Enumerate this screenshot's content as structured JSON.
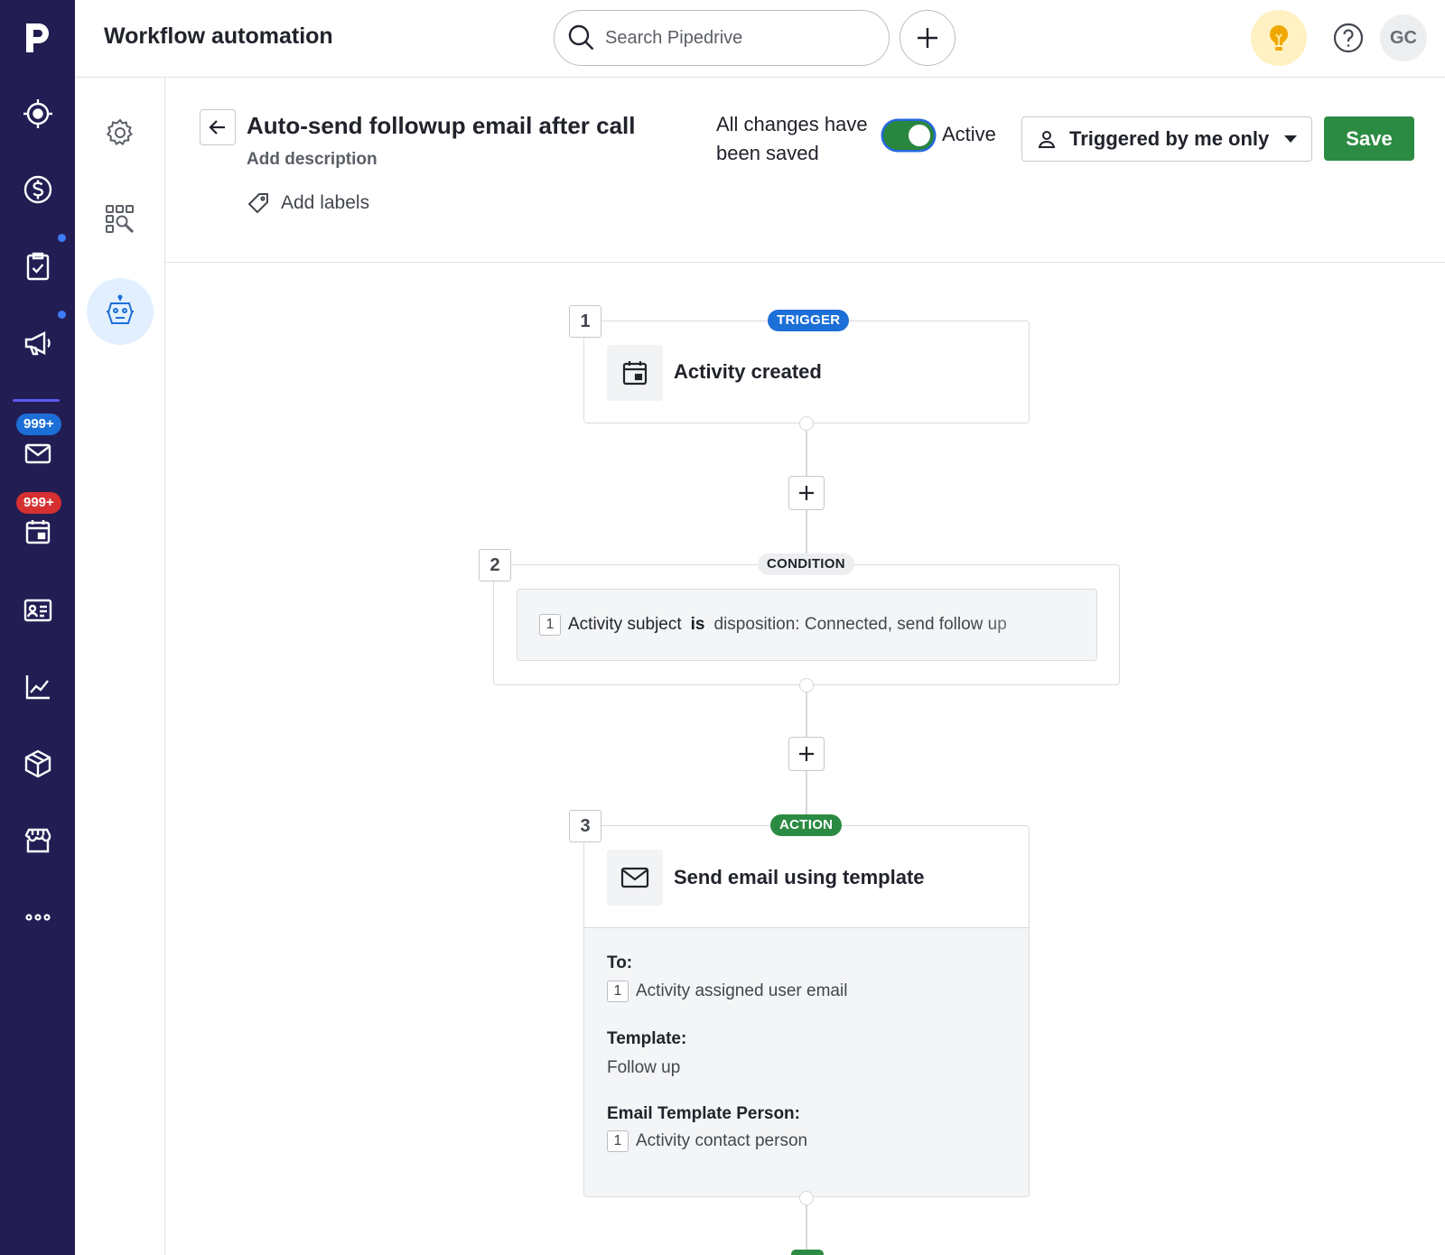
{
  "app": {
    "page_title": "Workflow automation",
    "search_placeholder": "Search Pipedrive",
    "avatar_initials": "GC",
    "brand_color": "#221d53",
    "accent_color": "#2c8b43"
  },
  "rail": {
    "badges": {
      "mail": "999+",
      "calendar": "999+"
    },
    "icons": [
      "target-icon",
      "dollar-icon",
      "clipboard-icon",
      "megaphone-icon",
      "mail-icon",
      "calendar-icon",
      "contacts-icon",
      "chart-icon",
      "box-icon",
      "store-icon",
      "more-icon"
    ]
  },
  "workflow": {
    "title": "Auto-send followup email after call",
    "description_placeholder": "Add description",
    "labels_placeholder": "Add labels",
    "save_status": "All changes have been saved",
    "active_label": "Active",
    "active": true,
    "trigger_scope": "Triggered by me only",
    "save_label": "Save"
  },
  "steps": {
    "trigger": {
      "number": "1",
      "tag": "TRIGGER",
      "title": "Activity created"
    },
    "condition": {
      "number": "2",
      "tag": "CONDITION",
      "ref": "1",
      "field": "Activity subject",
      "operator": "is",
      "value": "disposition: Connected, send follow up"
    },
    "action": {
      "number": "3",
      "tag": "ACTION",
      "title": "Send email using template",
      "to_label": "To:",
      "to_ref": "1",
      "to_value": "Activity assigned user email",
      "template_label": "Template:",
      "template_value": "Follow up",
      "person_label": "Email Template Person:",
      "person_ref": "1",
      "person_value": "Activity contact person"
    }
  }
}
